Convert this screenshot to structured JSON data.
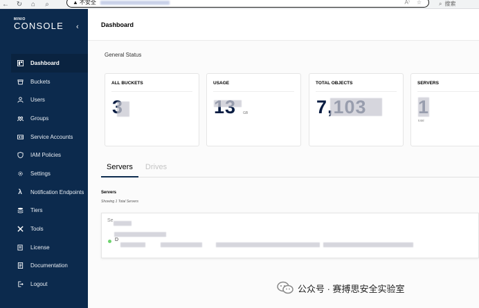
{
  "browser": {
    "security_label": "不安全",
    "search_label": "搜索"
  },
  "sidebar": {
    "logo_small": "MINIO",
    "logo_main": "CONSOLE",
    "items": [
      {
        "label": "Dashboard",
        "icon": "dashboard-icon",
        "active": true
      },
      {
        "label": "Buckets",
        "icon": "bucket-icon"
      },
      {
        "label": "Users",
        "icon": "user-icon"
      },
      {
        "label": "Groups",
        "icon": "groups-icon"
      },
      {
        "label": "Service Accounts",
        "icon": "service-accounts-icon"
      },
      {
        "label": "IAM Policies",
        "icon": "shield-icon"
      },
      {
        "label": "Settings",
        "icon": "gear-icon"
      },
      {
        "label": "Notification Endpoints",
        "icon": "lambda-icon"
      },
      {
        "label": "Tiers",
        "icon": "tiers-icon"
      },
      {
        "label": "Tools",
        "icon": "tools-icon"
      },
      {
        "label": "License",
        "icon": "license-icon"
      },
      {
        "label": "Documentation",
        "icon": "documentation-icon"
      },
      {
        "label": "Logout",
        "icon": "logout-icon"
      }
    ]
  },
  "main": {
    "title": "Dashboard",
    "section_title": "General Status",
    "cards": [
      {
        "title": "ALL BUCKETS",
        "value": "3",
        "unit": "",
        "sub": ""
      },
      {
        "title": "USAGE",
        "value": "13",
        "unit": "GB",
        "sub": ""
      },
      {
        "title": "TOTAL OBJECTS",
        "value": "7,103",
        "unit": "",
        "sub": ""
      },
      {
        "title": "SERVERS",
        "value": "1",
        "unit": "",
        "sub": "total"
      }
    ],
    "tabs": [
      {
        "label": "Servers",
        "active": true
      },
      {
        "label": "Drives",
        "active": false
      }
    ],
    "servers_label": "Servers",
    "servers_sub": "Showing 1 Total Servers",
    "server": {
      "name": "Se",
      "row_text": "D"
    }
  },
  "watermark": {
    "text": "公众号 · 赛搏思安全实验室"
  },
  "colors": {
    "sidebar_bg": "#0c2a4d",
    "value_color": "#081c42",
    "status_green": "#6ed36e"
  }
}
